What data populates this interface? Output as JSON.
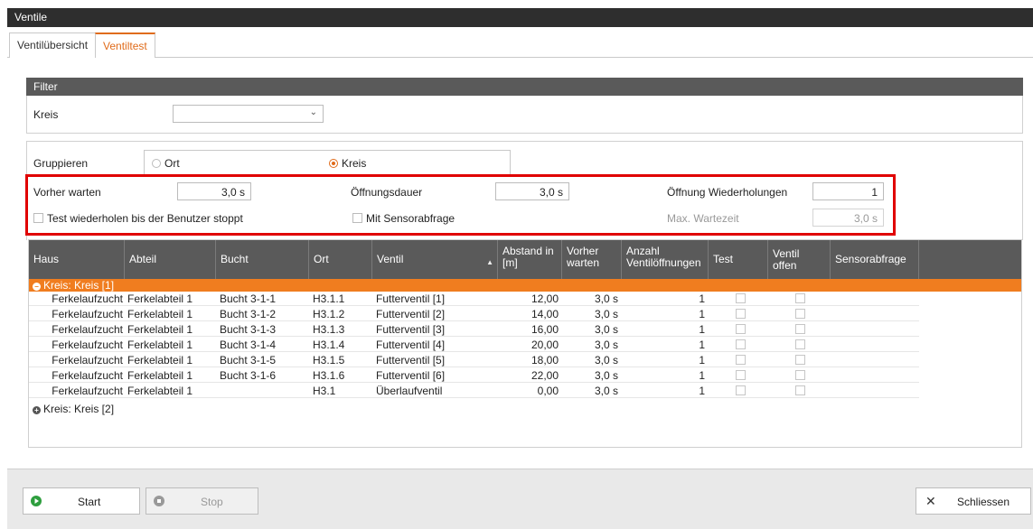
{
  "window": {
    "title": "Ventile"
  },
  "tabs": [
    {
      "label": "Ventilübersicht",
      "active": false
    },
    {
      "label": "Ventiltest",
      "active": true
    }
  ],
  "filter": {
    "header": "Filter",
    "kreis_label": "Kreis",
    "kreis_value": ""
  },
  "group": {
    "label": "Gruppieren",
    "options": [
      {
        "label": "Ort",
        "selected": false
      },
      {
        "label": "Kreis",
        "selected": true
      }
    ]
  },
  "settings": {
    "vorher_warten_label": "Vorher warten",
    "vorher_warten_value": "3,0 s",
    "oeffnungsdauer_label": "Öffnungsdauer",
    "oeffnungsdauer_value": "3,0 s",
    "wiederholungen_label": "Öffnung Wiederholungen",
    "wiederholungen_value": "1",
    "test_wiederholen_label": "Test wiederholen bis der Benutzer stoppt",
    "sensorabfrage_label": "Mit Sensorabfrage",
    "max_wartezeit_label": "Max. Wartezeit",
    "max_wartezeit_value": "3,0 s"
  },
  "grid": {
    "columns": [
      "Haus",
      "Abteil",
      "Bucht",
      "Ort",
      "Ventil",
      "Abstand in [m]",
      "Vorher warten",
      "Anzahl Ventilöffnungen",
      "Test",
      "Ventil offen",
      "Sensorabfrage"
    ],
    "groups": [
      {
        "label": "Kreis: Kreis [1]",
        "expanded": true,
        "rows": [
          {
            "haus": "Ferkelaufzucht",
            "abteil": "Ferkelabteil 1",
            "bucht": "Bucht 3-1-1",
            "ort": "H3.1.1",
            "ventil": "Futterventil [1]",
            "abstand": "12,00",
            "warten": "3,0 s",
            "anzahl": "1"
          },
          {
            "haus": "Ferkelaufzucht",
            "abteil": "Ferkelabteil 1",
            "bucht": "Bucht 3-1-2",
            "ort": "H3.1.2",
            "ventil": "Futterventil [2]",
            "abstand": "14,00",
            "warten": "3,0 s",
            "anzahl": "1"
          },
          {
            "haus": "Ferkelaufzucht",
            "abteil": "Ferkelabteil 1",
            "bucht": "Bucht 3-1-3",
            "ort": "H3.1.3",
            "ventil": "Futterventil [3]",
            "abstand": "16,00",
            "warten": "3,0 s",
            "anzahl": "1"
          },
          {
            "haus": "Ferkelaufzucht",
            "abteil": "Ferkelabteil 1",
            "bucht": "Bucht 3-1-4",
            "ort": "H3.1.4",
            "ventil": "Futterventil [4]",
            "abstand": "20,00",
            "warten": "3,0 s",
            "anzahl": "1"
          },
          {
            "haus": "Ferkelaufzucht",
            "abteil": "Ferkelabteil 1",
            "bucht": "Bucht 3-1-5",
            "ort": "H3.1.5",
            "ventil": "Futterventil [5]",
            "abstand": "18,00",
            "warten": "3,0 s",
            "anzahl": "1"
          },
          {
            "haus": "Ferkelaufzucht",
            "abteil": "Ferkelabteil 1",
            "bucht": "Bucht 3-1-6",
            "ort": "H3.1.6",
            "ventil": "Futterventil [6]",
            "abstand": "22,00",
            "warten": "3,0 s",
            "anzahl": "1"
          },
          {
            "haus": "Ferkelaufzucht",
            "abteil": "Ferkelabteil 1",
            "bucht": "",
            "ort": "H3.1",
            "ventil": "Überlaufventil",
            "abstand": "0,00",
            "warten": "3,0 s",
            "anzahl": "1"
          }
        ]
      },
      {
        "label": "Kreis: Kreis [2]",
        "expanded": false,
        "rows": []
      }
    ]
  },
  "buttons": {
    "start": "Start",
    "stop": "Stop",
    "close": "Schliessen"
  },
  "colors": {
    "accent": "#f07d1f",
    "highlight": "#e00000",
    "header": "#5a5a5a",
    "start_icon": "#2e9e3e"
  }
}
